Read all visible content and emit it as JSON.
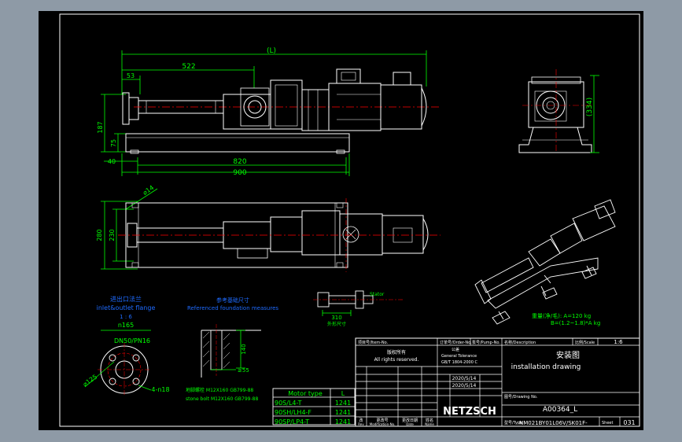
{
  "dims": {
    "overall_length": "(L)",
    "d522": "522",
    "d53": "53",
    "d187": "187",
    "d75": "75",
    "d40": "40",
    "d820": "820",
    "d900": "900",
    "d334": "(334)",
    "d280": "280",
    "d230": "230",
    "d_phi14": "⌀14",
    "d310": "310"
  },
  "flange": {
    "title_cn": "进出口法兰",
    "title_en": "inlet&outlet flange",
    "scale": "1 : 6",
    "n165": "n165",
    "dn": "DN50/PN16",
    "phi125": "⌀125",
    "holes": "4-n18"
  },
  "foundation": {
    "title_cn": "参考基础尺寸",
    "title_en": "Referenced foundation measures",
    "h140": "140",
    "d55": "≥55",
    "bolt_cn": "地脚螺栓 M12X160 GB799-88",
    "bolt_en": "stone bolt     M12X160 GB799-88"
  },
  "small_view": {
    "label": "Stator",
    "d310": "310",
    "sub": "外形尺寸"
  },
  "weight_note": {
    "line1": "重量(净/毛): A=120  kg",
    "line2": "B=(1.2~1.8)*A  kg"
  },
  "motor_table": {
    "header": [
      "Motor type",
      "L"
    ],
    "rows": [
      [
        "90S/L4-T",
        "1241"
      ],
      [
        "90SH/LH4-F",
        "1241"
      ],
      [
        "90SP/LP4-T",
        "1241"
      ]
    ]
  },
  "title_block": {
    "item": "项目号/Item-No.",
    "order": "订单号/Order-No.",
    "pump": "泵号/Pump-No.",
    "description": "名称/Description",
    "scale_label": "比例/Scale",
    "scale": "1:6",
    "copyright_cn": "版权所有",
    "copyright_en": "All rights reserved.",
    "title_cn": "安装图",
    "title_en": "installation drawing",
    "tolerance_cn": "公差",
    "tolerance": "General Tolerance",
    "tolerance_std": "GB/T 1804-2000 C",
    "date1": "2020/5/14",
    "date2": "2020/5/14",
    "drawing_no_label": "图号/Drawing No.",
    "drawing_no": "A00364_L",
    "brand": "NETZSCH",
    "type_label": "型号/Type",
    "type": "NM021BY01L06V/SK01F-",
    "page": "031",
    "rev_cols": [
      "改",
      "更改号",
      "更改日期",
      "姓名"
    ],
    "rev_cols_en": [
      "Rev",
      "Modification-No.",
      "Date",
      "Name"
    ],
    "sheet_label": "Sheet"
  }
}
